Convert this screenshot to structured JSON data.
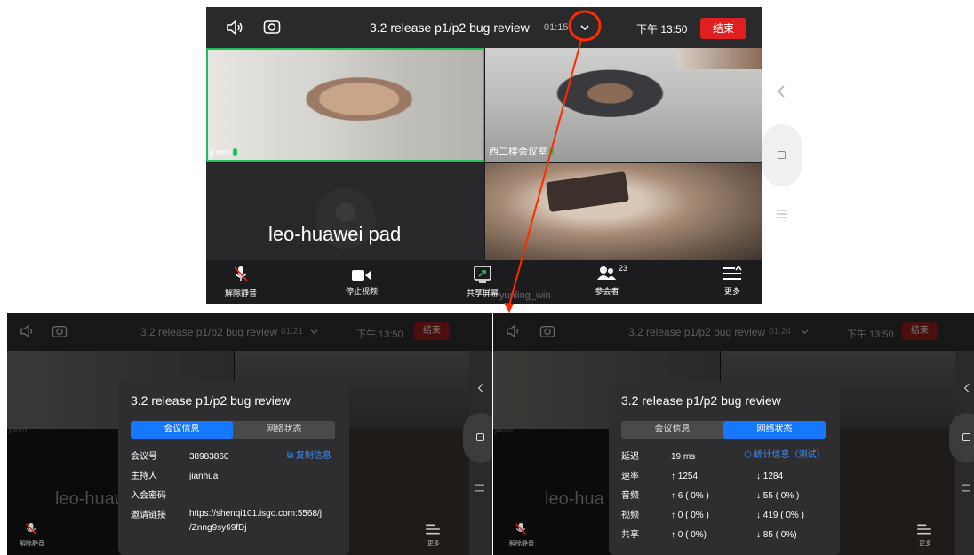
{
  "top": {
    "title": "3.2 release p1/p2 bug review",
    "duration": "01:15",
    "clock": "下午 13:50",
    "end_label": "结束",
    "participants": {
      "junru": "junru",
      "room": "西二楼会议室",
      "pad": "leo-huawei pad",
      "win": "yunling_win"
    },
    "toolbar": {
      "unmute": "解除静音",
      "stop_video": "停止视频",
      "share": "共享屏幕",
      "participants": "参会者",
      "participants_count": "23",
      "more": "更多"
    }
  },
  "left": {
    "title": "3.2 release p1/p2 bug review",
    "duration": "01:21",
    "clock": "下午 13:50",
    "end_label": "结束",
    "bg_name": "leo-huawei pad",
    "bg_junru": "junru",
    "unmute": "解除静音",
    "more": "更多",
    "panel": {
      "title": "3.2 release p1/p2 bug review",
      "tab_info": "会议信息",
      "tab_net": "网络状态",
      "meeting_id_label": "会议号",
      "meeting_id": "38983860",
      "copy_info": "复制信息",
      "host_label": "主持人",
      "host": "jianhua",
      "password_label": "入会密码",
      "password": "",
      "link_label": "邀请链接",
      "link_line1": "https://shenqi101.isgo.com:5568/j",
      "link_line2": "/Znng9sy69fDj"
    }
  },
  "right": {
    "title": "3.2 release p1/p2 bug review",
    "duration": "01:24",
    "clock": "下午 13:50",
    "end_label": "结束",
    "bg_name": "leo-hua",
    "bg_junru": "junru",
    "unmute": "解除静音",
    "more": "更多",
    "panel": {
      "title": "3.2 release p1/p2 bug review",
      "tab_info": "会议信息",
      "tab_net": "网络状态",
      "stats_link": "统计信息（测试）",
      "rows": [
        {
          "label": "延迟",
          "up": "19 ms",
          "down": ""
        },
        {
          "label": "速率",
          "up": "↑ 1254",
          "down": "↓ 1284"
        },
        {
          "label": "音频",
          "up": "↑ 6 ( 0% )",
          "down": "↓ 55 ( 0% )"
        },
        {
          "label": "视频",
          "up": "↑ 0 ( 0% )",
          "down": "↓ 419 ( 0% )"
        },
        {
          "label": "共享",
          "up": "↑ 0 ( 0%)",
          "down": "↓ 85 ( 0%)"
        }
      ]
    }
  },
  "colors": {
    "end": "#e02020",
    "accent_blue": "#1677ff",
    "annotation_red": "#ff2a00",
    "speaker_green": "#1fbf5a"
  }
}
